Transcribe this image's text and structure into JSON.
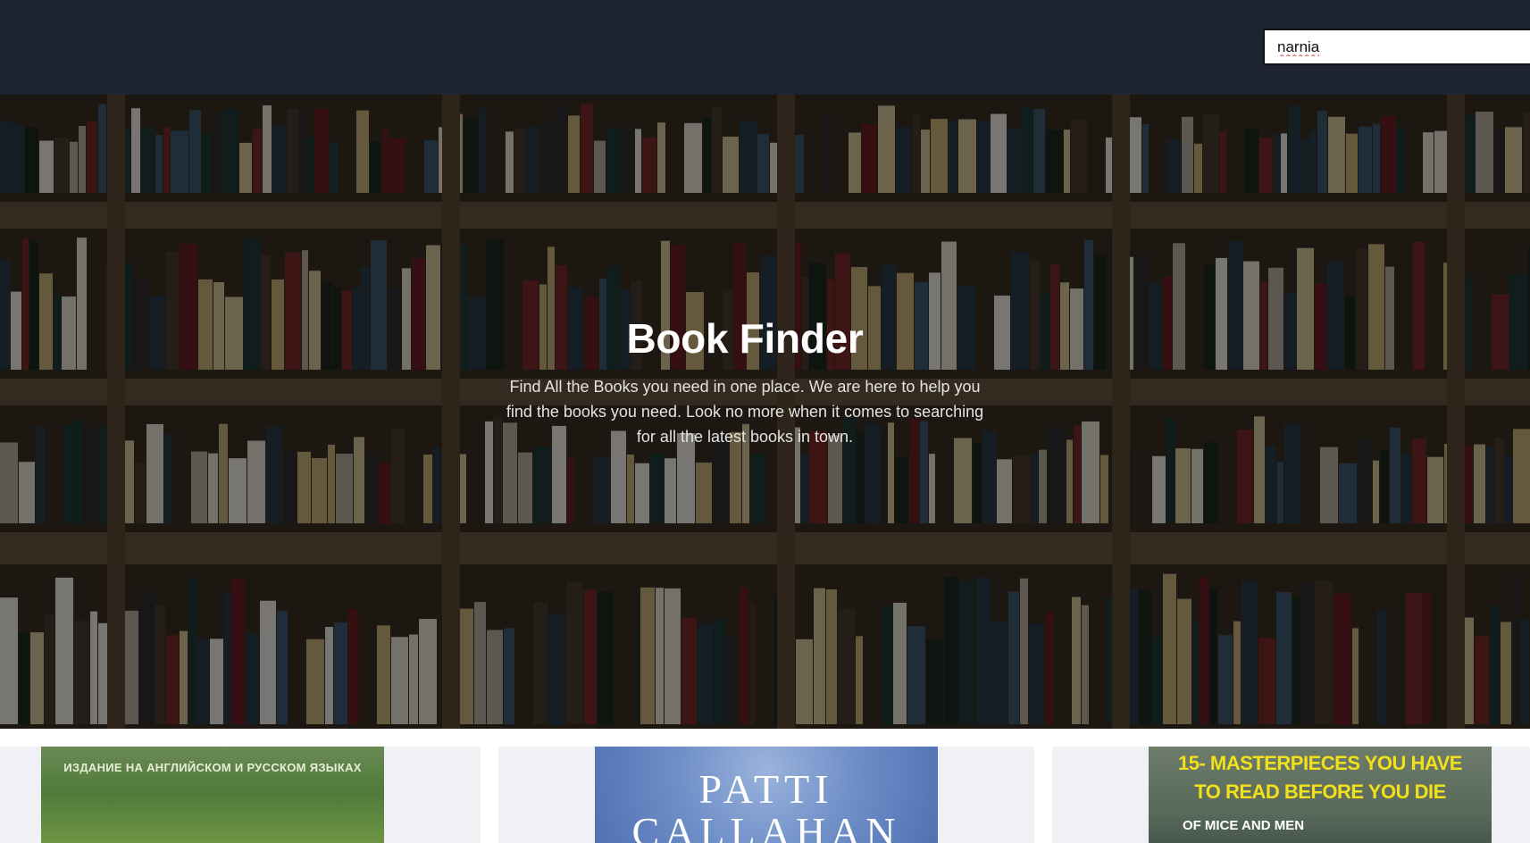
{
  "search": {
    "value": "narnia",
    "placeholder": ""
  },
  "hero": {
    "title": "Book Finder",
    "description": "Find All the Books you need in one place. We are here to help you find the books you need. Look no more when it comes to searching for all the latest books in town."
  },
  "results": [
    {
      "cover_text": "ИЗДАНИЕ НА АНГЛИЙСКОМ И РУССКОМ ЯЗЫКАХ"
    },
    {
      "cover_text_line1": "PATTI",
      "cover_text_line2": "CALLAHAN"
    },
    {
      "cover_text_line1": "15- MASTERPIECES YOU HAVE",
      "cover_text_line2": "TO READ BEFORE YOU DIE",
      "cover_text_line3": "OF MICE AND MEN"
    }
  ],
  "colors": {
    "topbar": "#1e2430",
    "card_bg": "#f0f1f4",
    "hero_text": "#ffffff"
  }
}
